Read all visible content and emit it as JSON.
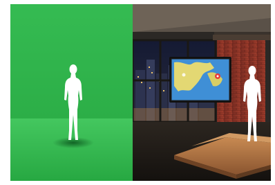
{
  "image": {
    "description_panels": [
      "green-screen",
      "virtual-studio"
    ],
    "colors": {
      "background": "#ffffff",
      "green_light": "#3cc25a",
      "green_dark": "#22a23e",
      "silhouette": "#ffffff",
      "brick": "#8a3326",
      "floor_wood": "#a6673a",
      "screen_sea": "#3f8fd6",
      "screen_land": "#e3d873",
      "night_sky": "#1b2340"
    },
    "icons": [
      "person-silhouette",
      "weather-map",
      "map-pin"
    ]
  }
}
